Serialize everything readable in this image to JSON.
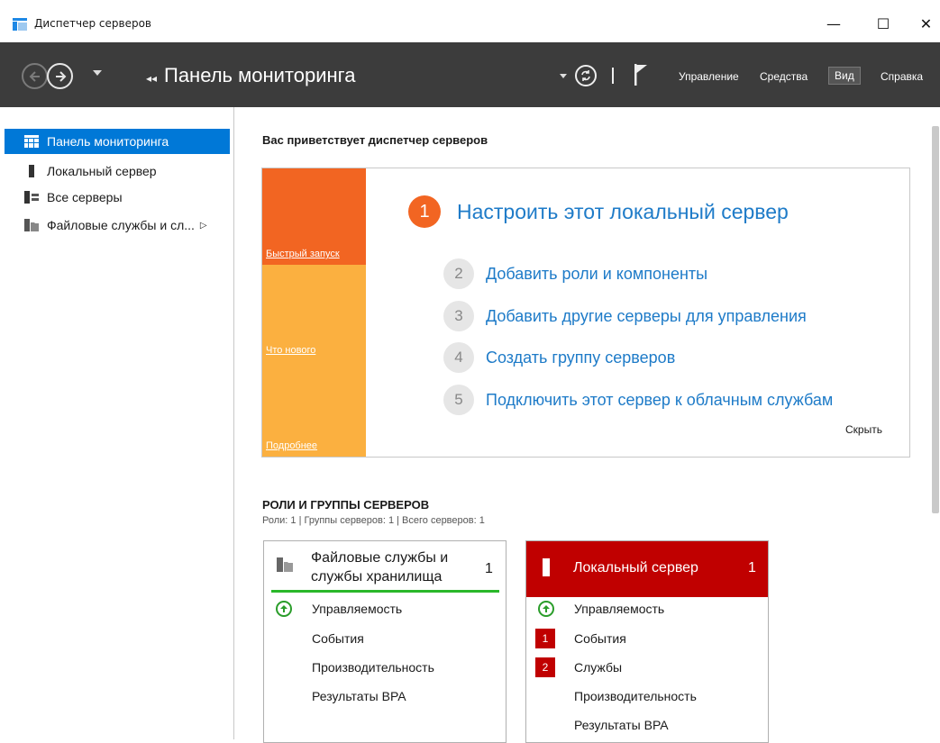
{
  "window": {
    "title": "Диспетчер серверов",
    "minimize": "—",
    "maximize": "☐",
    "close": "✕"
  },
  "toolbar": {
    "breadcrumb": "Панель мониторинга",
    "menu": {
      "manage": "Управление",
      "tools": "Средства",
      "view": "Вид",
      "help": "Справка"
    }
  },
  "sidebar": {
    "items": [
      {
        "label": "Панель мониторинга",
        "icon": "dashboard-icon"
      },
      {
        "label": "Локальный сервер",
        "icon": "server-icon"
      },
      {
        "label": "Все серверы",
        "icon": "servers-icon"
      },
      {
        "label": "Файловые службы и сл...",
        "icon": "file-services-icon"
      }
    ]
  },
  "welcome": {
    "title": "Вас приветствует диспетчер серверов"
  },
  "quickstart": {
    "tiles": [
      "Быстрый запуск",
      "Что нового",
      "Подробнее"
    ],
    "steps": [
      {
        "num": "1",
        "label": "Настроить этот локальный сервер"
      },
      {
        "num": "2",
        "label": "Добавить роли и компоненты"
      },
      {
        "num": "3",
        "label": "Добавить другие серверы для управления"
      },
      {
        "num": "4",
        "label": "Создать группу серверов"
      },
      {
        "num": "5",
        "label": "Подключить этот сервер к облачным службам"
      }
    ],
    "hide": "Скрыть"
  },
  "roles": {
    "title": "РОЛИ И ГРУППЫ СЕРВЕРОВ",
    "subtitle": "Роли: 1 | Группы серверов: 1 | Всего серверов: 1",
    "cards": [
      {
        "title_line1": "Файловые службы и",
        "title_line2": "службы хранилища",
        "count": "1",
        "rows": [
          "Управляемость",
          "События",
          "Производительность",
          "Результаты BPA"
        ]
      },
      {
        "title": "Локальный сервер",
        "count": "1",
        "rows": [
          "Управляемость",
          "События",
          "Службы",
          "Производительность",
          "Результаты BPA"
        ],
        "badges": {
          "events": "1",
          "services": "2"
        }
      }
    ]
  },
  "colors": {
    "accent": "#0078d7",
    "orange": "#f26522",
    "tile_yellow": "#fbb040",
    "red": "#c00000",
    "green": "#2a9d2a"
  }
}
